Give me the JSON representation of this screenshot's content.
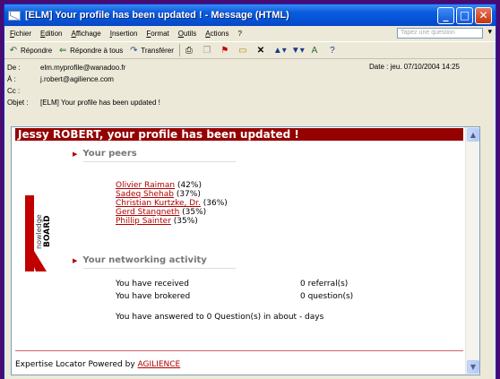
{
  "window": {
    "title": "[ELM] Your profile has been updated ! - Message (HTML)"
  },
  "menubar": {
    "items": [
      "Fichier",
      "Edition",
      "Affichage",
      "Insertion",
      "Format",
      "Outils",
      "Actions",
      "?"
    ],
    "question_placeholder": "Tapez une question"
  },
  "toolbar": {
    "reply": "Répondre",
    "reply_all": "Répondre à tous",
    "forward": "Transférer"
  },
  "headers": {
    "from_label": "De :",
    "from": "elm.myprofile@wanadoo.fr",
    "to_label": "À :",
    "to": "j.robert@agilience.com",
    "cc_label": "Cc :",
    "cc": "",
    "subject_label": "Objet :",
    "subject": "[ELM] Your profile has been updated !",
    "date": "Date : jeu. 07/10/2004 14:25"
  },
  "message": {
    "banner": "Jessy ROBERT, your profile has been updated !",
    "logo_top": "nowledge",
    "logo_bottom": "BOARD",
    "peers_title": "Your peers",
    "peers": [
      {
        "name": "Olivier Raiman",
        "pct": " (42%)"
      },
      {
        "name": "Sadeq Shehab",
        "pct": " (37%)"
      },
      {
        "name": "Christian Kurtzke, Dr.",
        "pct": " (36%)"
      },
      {
        "name": "Gerd Stangneth",
        "pct": " (35%)"
      },
      {
        "name": "Phillip Sainter",
        "pct": " (35%)"
      }
    ],
    "activity_title": "Your networking activity",
    "received_label": "You have received",
    "received_value": "0 referral(s)",
    "brokered_label": "You have brokered",
    "brokered_value": "0 question(s)",
    "answered": "You have answered to 0 Question(s) in about - days",
    "footer_text": "Expertise Locator Powered by ",
    "footer_link": "AGILIENCE"
  },
  "colors": {
    "banner": "#950000",
    "link": "#b00000",
    "desktop": "#4a0a6e"
  }
}
